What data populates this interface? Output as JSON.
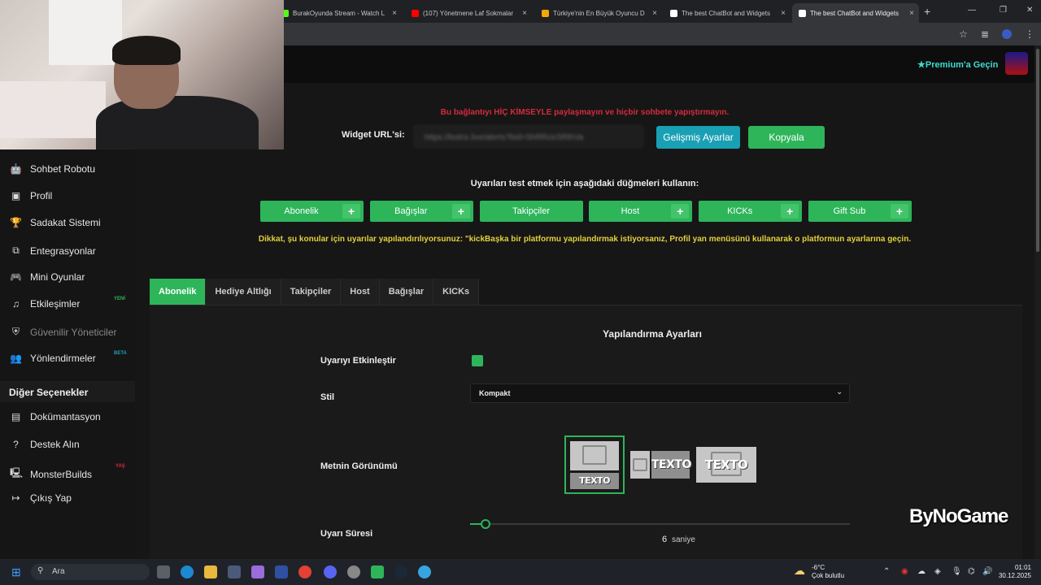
{
  "browser": {
    "tabs": [
      {
        "title": "BurakOyunda Stream - Watch L",
        "favicon_color": "#53fc18"
      },
      {
        "title": "(107) Yönetmene Laf Sokmalar",
        "favicon_color": "#ff0000"
      },
      {
        "title": "Türkiye'nin En Büyük Oyuncu D",
        "favicon_color": "#f2a900"
      },
      {
        "title": "The best ChatBot and Widgets",
        "favicon_color": "#ffffff"
      },
      {
        "title": "The best ChatBot and Widgets",
        "favicon_color": "#ffffff"
      }
    ],
    "new_tab": "+",
    "close_glyph": "×"
  },
  "header": {
    "premium_label": "Premium'a Geçin",
    "premium_star": "★",
    "accent": "#3ddbcf"
  },
  "sidebar": {
    "items": [
      {
        "label": "Sohbet Robotu",
        "icon": "robot-icon",
        "glyph": "🤖"
      },
      {
        "label": "Profil",
        "icon": "id-card-icon",
        "glyph": "▣"
      },
      {
        "label": "Sadakat Sistemi",
        "icon": "trophy-icon",
        "glyph": "🏆"
      },
      {
        "label": "Entegrasyonlar",
        "icon": "integration-icon",
        "glyph": "⧉"
      },
      {
        "label": "Mini Oyunlar",
        "icon": "gamepad-icon",
        "glyph": "🎮"
      },
      {
        "label": "Etkileşimler",
        "icon": "music-icon",
        "glyph": "♫",
        "badge": "YENİ"
      },
      {
        "label": "Güvenilir Yöneticiler",
        "icon": "shield-icon",
        "glyph": "⛨"
      },
      {
        "label": "Yönlendirmeler",
        "icon": "users-icon",
        "glyph": "👥",
        "badge": "BETA"
      }
    ],
    "section_title": "Diğer Seçenekler",
    "other_items": [
      {
        "label": "Dokümantasyon",
        "icon": "document-icon",
        "glyph": "▤"
      },
      {
        "label": "Destek Alın",
        "icon": "help-icon",
        "glyph": "?"
      },
      {
        "label": "MonsterBuilds",
        "icon": "monitor-icon",
        "glyph": "🖳",
        "badge": "YAŞ"
      },
      {
        "label": "Çıkış Yap",
        "icon": "logout-icon",
        "glyph": "↦"
      }
    ]
  },
  "widget": {
    "warning": "Bu bağlantıyı HİÇ KİMSEYLE paylaşmayın ve hiçbir sohbete yapıştırmayın.",
    "url_label": "Widget URL'si:",
    "url_value": "https://botrix.live/alerts?bid=ShRRcic5RlhVa",
    "advanced_button": "Gelişmiş Ayarlar",
    "copy_button": "Kopyala"
  },
  "test": {
    "instruction": "Uyarıları test etmek için aşağıdaki düğmeleri kullanın:",
    "buttons": [
      {
        "label": "Abonelik",
        "plus": true
      },
      {
        "label": "Bağışlar",
        "plus": true
      },
      {
        "label": "Takipçiler",
        "plus": false
      },
      {
        "label": "Host",
        "plus": true
      },
      {
        "label": "KICKs",
        "plus": true
      },
      {
        "label": "Gift Sub",
        "plus": true
      }
    ],
    "notice": "Dikkat, şu konular için uyarılar yapılandırılıyorsunuz: \"kickBaşka bir platformu yapılandırmak istiyorsanız, Profil yan menüsünü kullanarak o platformun ayarlarına geçin."
  },
  "config_tabs": [
    "Abonelik",
    "Hediye Altlığı",
    "Takipçiler",
    "Host",
    "Bağışlar",
    "KICKs"
  ],
  "config": {
    "title": "Yapılandırma Ayarları",
    "enable_label": "Uyarıyı Etkinleştir",
    "enabled": true,
    "style_label": "Stil",
    "style_value": "Kompakt",
    "text_view_label": "Metnin Görünümü",
    "texto": "TEXTO",
    "duration_label": "Uyarı Süresi",
    "duration_value": "6",
    "duration_unit": "saniye",
    "duration_fraction": 0.04
  },
  "overlay": {
    "brand": "ByNoGame"
  },
  "taskbar": {
    "search_placeholder": "Ara",
    "weather_temp": "-6°C",
    "weather_desc": "Çok bulutlu",
    "time": "01:01",
    "date": "30.12.2025"
  },
  "colors": {
    "green": "#2eb55a",
    "teal": "#1aa0b4",
    "warning_red": "#d52b3c",
    "notice_yellow": "#e3cf3d"
  }
}
